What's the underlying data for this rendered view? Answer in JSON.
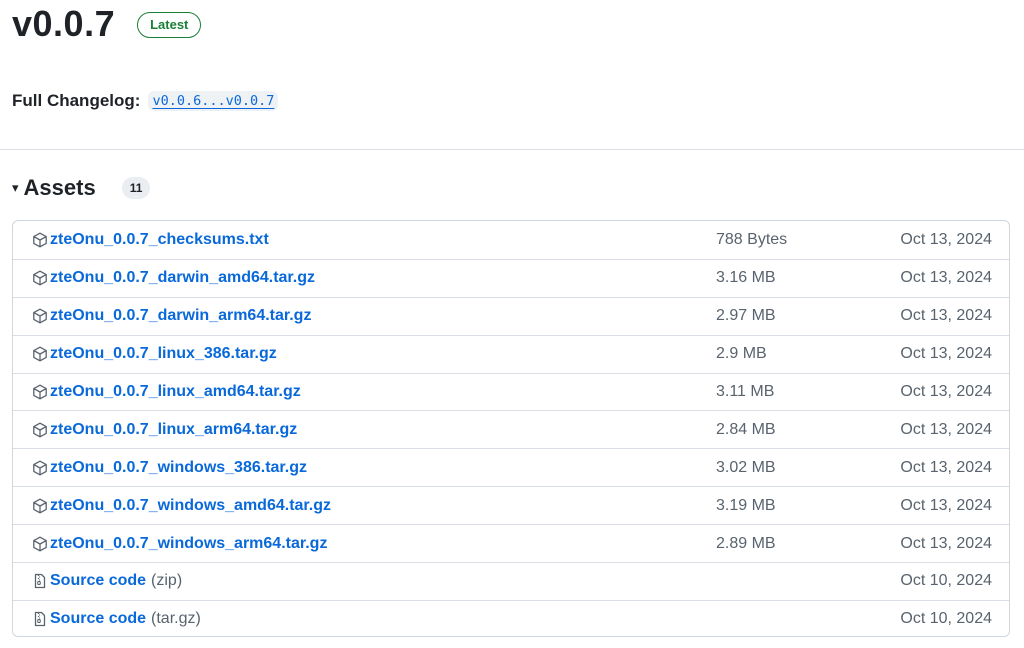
{
  "release": {
    "title": "v0.0.7",
    "badge": "Latest",
    "changelog_label": "Full Changelog",
    "changelog_colon": ":",
    "changelog_link": "v0.0.6...v0.0.7"
  },
  "assets": {
    "title": "Assets",
    "caret": "▾",
    "count": "11",
    "items": [
      {
        "name": "zteOnu_0.0.7_checksums.txt",
        "suffix": "",
        "size": "788 Bytes",
        "date": "Oct 13, 2024",
        "icon": "package-icon"
      },
      {
        "name": "zteOnu_0.0.7_darwin_amd64.tar.gz",
        "suffix": "",
        "size": "3.16 MB",
        "date": "Oct 13, 2024",
        "icon": "package-icon"
      },
      {
        "name": "zteOnu_0.0.7_darwin_arm64.tar.gz",
        "suffix": "",
        "size": "2.97 MB",
        "date": "Oct 13, 2024",
        "icon": "package-icon"
      },
      {
        "name": "zteOnu_0.0.7_linux_386.tar.gz",
        "suffix": "",
        "size": "2.9 MB",
        "date": "Oct 13, 2024",
        "icon": "package-icon"
      },
      {
        "name": "zteOnu_0.0.7_linux_amd64.tar.gz",
        "suffix": "",
        "size": "3.11 MB",
        "date": "Oct 13, 2024",
        "icon": "package-icon"
      },
      {
        "name": "zteOnu_0.0.7_linux_arm64.tar.gz",
        "suffix": "",
        "size": "2.84 MB",
        "date": "Oct 13, 2024",
        "icon": "package-icon"
      },
      {
        "name": "zteOnu_0.0.7_windows_386.tar.gz",
        "suffix": "",
        "size": "3.02 MB",
        "date": "Oct 13, 2024",
        "icon": "package-icon"
      },
      {
        "name": "zteOnu_0.0.7_windows_amd64.tar.gz",
        "suffix": "",
        "size": "3.19 MB",
        "date": "Oct 13, 2024",
        "icon": "package-icon"
      },
      {
        "name": "zteOnu_0.0.7_windows_arm64.tar.gz",
        "suffix": "",
        "size": "2.89 MB",
        "date": "Oct 13, 2024",
        "icon": "package-icon"
      },
      {
        "name": "Source code",
        "suffix": "(zip)",
        "size": "",
        "date": "Oct 10, 2024",
        "icon": "file-zip-icon"
      },
      {
        "name": "Source code",
        "suffix": "(tar.gz)",
        "size": "",
        "date": "Oct 10, 2024",
        "icon": "file-zip-icon"
      }
    ]
  },
  "colors": {
    "link": "#0969da",
    "badge_green": "#1a7f37",
    "muted": "#59636e",
    "border": "#d0d7de"
  }
}
